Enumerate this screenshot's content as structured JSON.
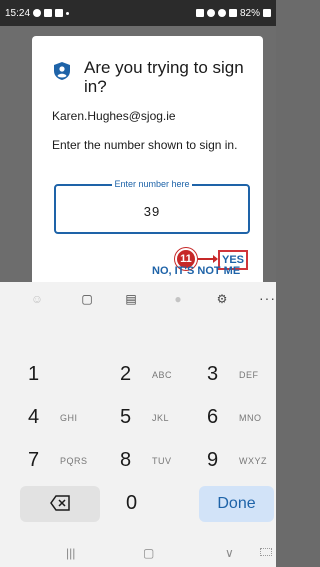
{
  "status_bar": {
    "time": "15:24",
    "battery": "82%"
  },
  "dialog": {
    "title": "Are you trying to sign in?",
    "email": "Karen.Hughes@sjog.ie",
    "instruction": "Enter the number shown to sign in.",
    "field_label": "Enter number here",
    "field_value": "39",
    "yes_label": "YES",
    "no_label": "NO, IT'S NOT ME",
    "step_badge": "11"
  },
  "keyboard": {
    "keys": [
      {
        "num": "1",
        "letters": ""
      },
      {
        "num": "2",
        "letters": "ABC"
      },
      {
        "num": "3",
        "letters": "DEF"
      },
      {
        "num": "4",
        "letters": "GHI"
      },
      {
        "num": "5",
        "letters": "JKL"
      },
      {
        "num": "6",
        "letters": "MNO"
      },
      {
        "num": "7",
        "letters": "PQRS"
      },
      {
        "num": "8",
        "letters": "TUV"
      },
      {
        "num": "9",
        "letters": "WXYZ"
      }
    ],
    "zero": "0",
    "done_label": "Done",
    "toolbar_more": "···"
  },
  "colors": {
    "accent": "#1e63a8",
    "annotation": "#c62828",
    "done_bg": "#d2e3f8"
  }
}
